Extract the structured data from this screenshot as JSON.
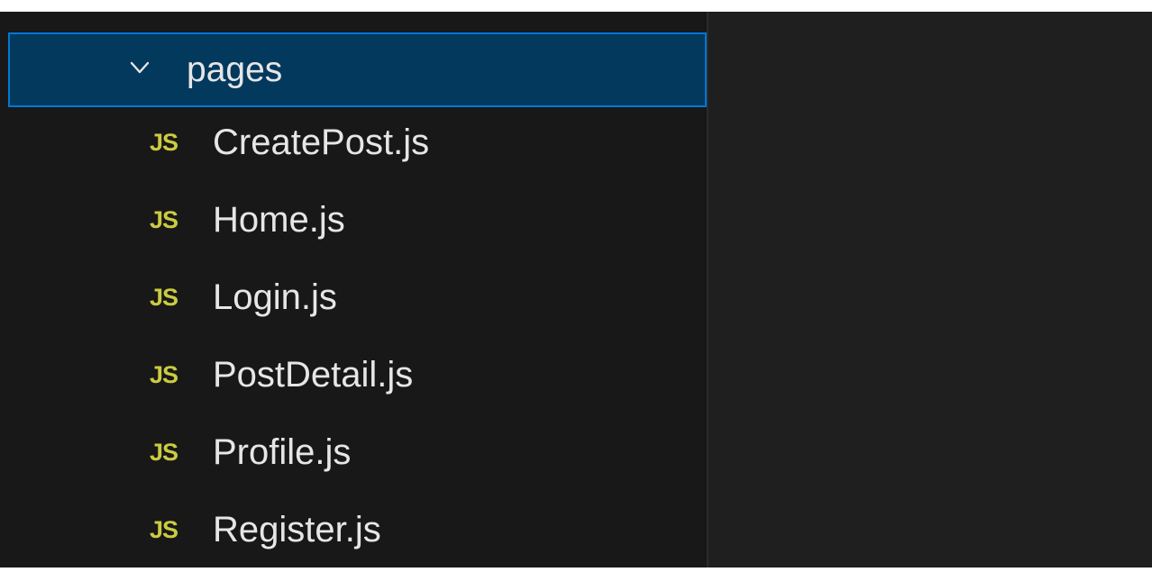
{
  "explorer": {
    "folder": {
      "name": "pages",
      "expanded": true,
      "icon": "chevron-down-icon"
    },
    "files": [
      {
        "badge": "JS",
        "name": "CreatePost.js"
      },
      {
        "badge": "JS",
        "name": "Home.js"
      },
      {
        "badge": "JS",
        "name": "Login.js"
      },
      {
        "badge": "JS",
        "name": "PostDetail.js"
      },
      {
        "badge": "JS",
        "name": "Profile.js"
      },
      {
        "badge": "JS",
        "name": "Register.js"
      }
    ]
  },
  "colors": {
    "selection_bg": "#04395e",
    "selection_border": "#0078d4",
    "js_badge": "#cbcb41",
    "text": "#e6e6e6",
    "sidebar_bg": "#181818",
    "editor_bg": "#1f1f1f"
  }
}
